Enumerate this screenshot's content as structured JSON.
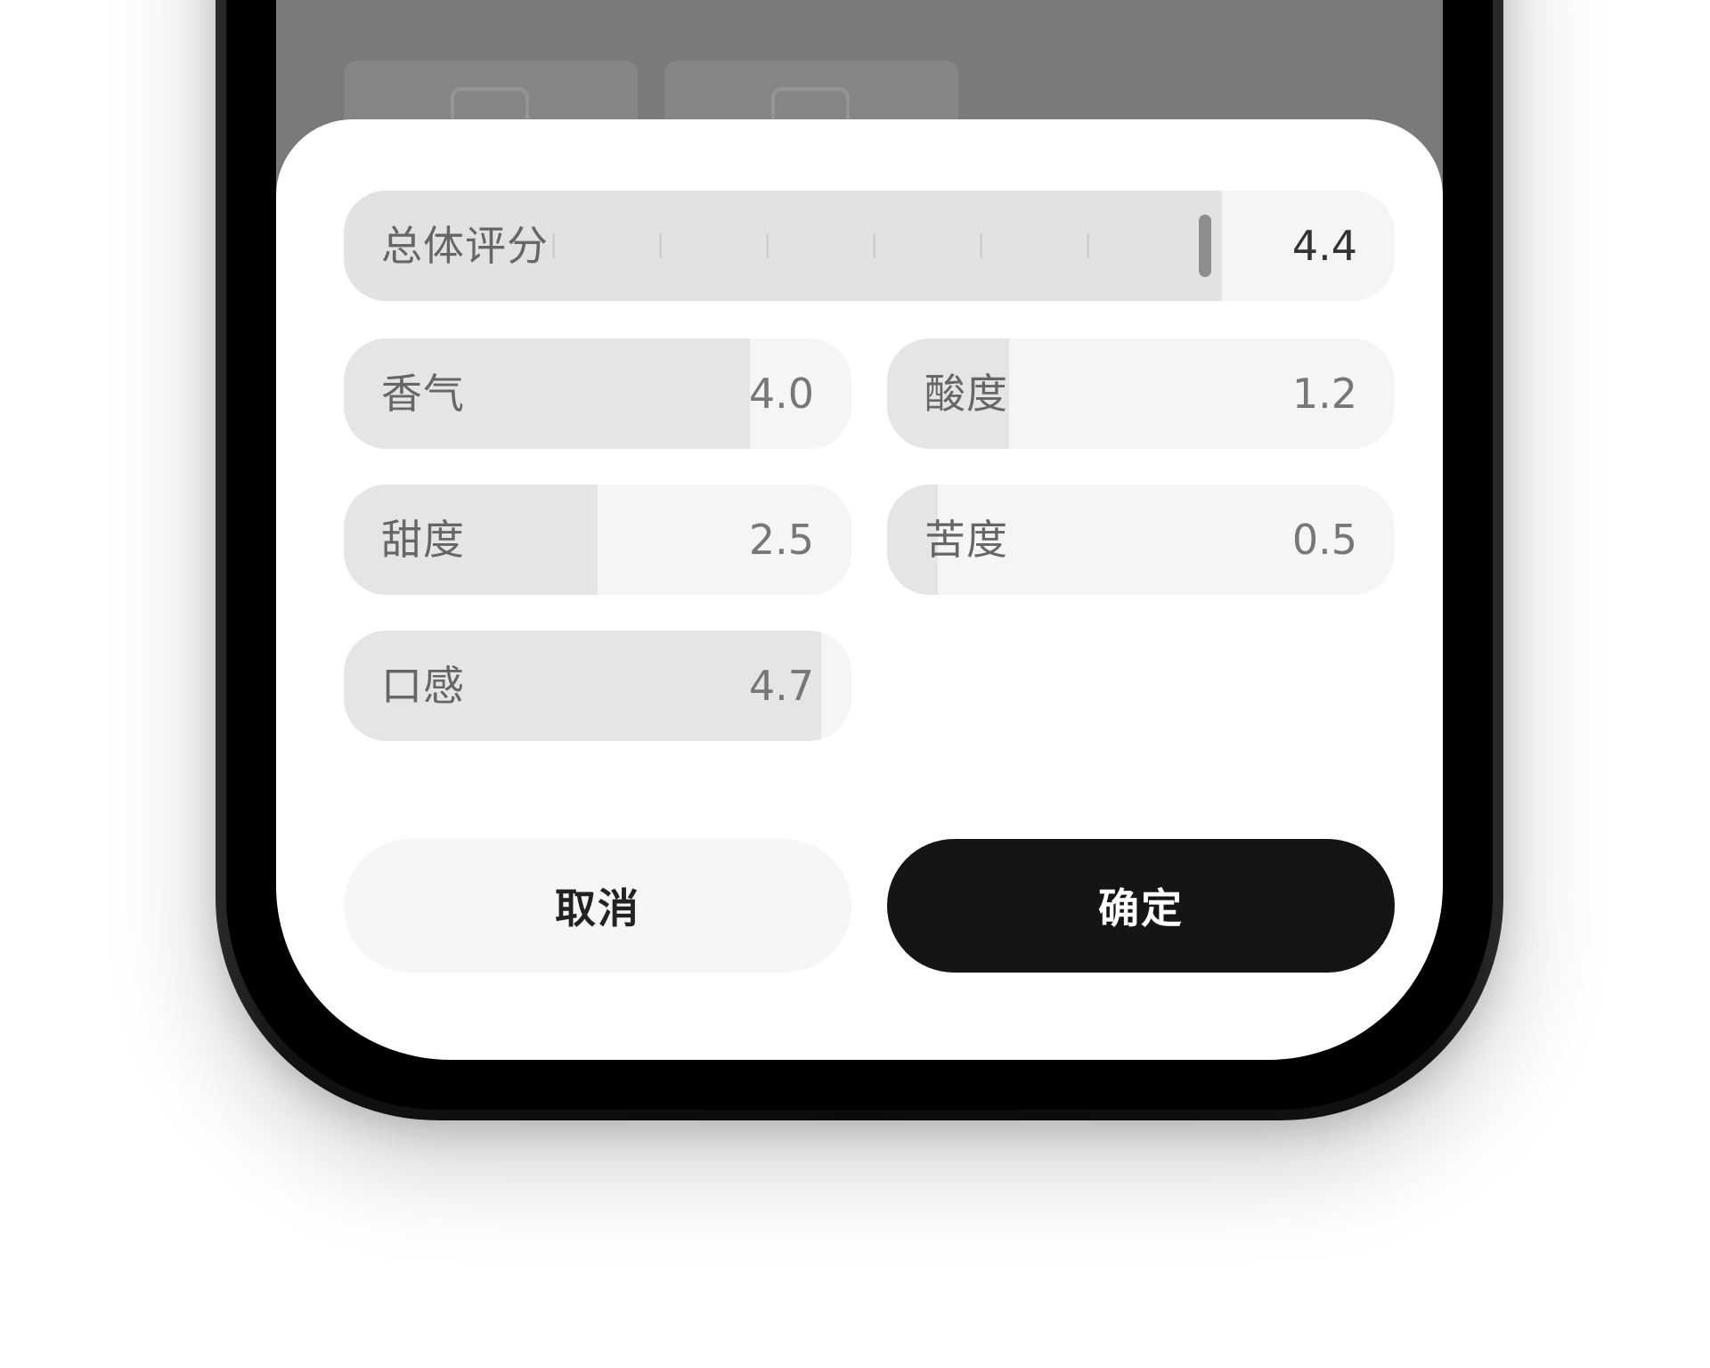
{
  "rating_sheet": {
    "overall": {
      "label": "总体评分",
      "value": "4.4",
      "max": 5,
      "numeric": 4.4
    },
    "attributes": [
      {
        "key": "aroma",
        "label": "香气",
        "value": "4.0",
        "numeric": 4.0
      },
      {
        "key": "acidity",
        "label": "酸度",
        "value": "1.2",
        "numeric": 1.2
      },
      {
        "key": "sweetness",
        "label": "甜度",
        "value": "2.5",
        "numeric": 2.5
      },
      {
        "key": "bitterness",
        "label": "苦度",
        "value": "0.5",
        "numeric": 0.5
      },
      {
        "key": "mouthfeel",
        "label": "口感",
        "value": "4.7",
        "numeric": 4.7
      }
    ],
    "scale_max": 5,
    "cancel_label": "取消",
    "confirm_label": "确定"
  },
  "colors": {
    "confirm_bg": "#151515",
    "cancel_bg": "#f6f6f6",
    "track_bg": "#f5f5f5",
    "track_fill": "#e5e5e5"
  }
}
